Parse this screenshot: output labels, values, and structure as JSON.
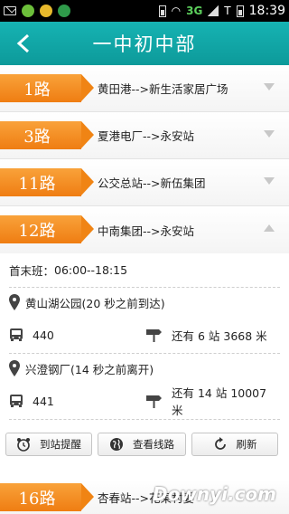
{
  "status_bar": {
    "network": "3G",
    "time": "18:39",
    "sim_label": "T"
  },
  "header": {
    "title": "一中初中部"
  },
  "routes": [
    {
      "number": "1路",
      "desc": "黄田港-->新生活家居广场"
    },
    {
      "number": "3路",
      "desc": "夏港电厂-->永安站"
    },
    {
      "number": "11路",
      "desc": "公交总站-->新伍集团"
    },
    {
      "number": "12路",
      "desc": "中南集团-->永安站"
    }
  ],
  "expanded": {
    "schedule_label": "首末班：",
    "schedule_time": "06:00--18:15",
    "stops": [
      {
        "name": "黄山湖公园(20 秒之前到达)",
        "bus": "440",
        "remaining": "还有 6 站 3668 米"
      },
      {
        "name": "兴澄钢厂(14 秒之前离开)",
        "bus": "441",
        "remaining": "还有 14 站 10007 米"
      }
    ]
  },
  "buttons": {
    "alarm": "到站提醒",
    "view_route": "查看线路",
    "refresh": "刷新"
  },
  "bottom_route": {
    "number": "16路",
    "desc": "杏春站-->花果村委"
  },
  "watermark": "Downyi.com",
  "colors": {
    "header_teal": "#0d9a9a",
    "tag_orange": "#f08414"
  }
}
